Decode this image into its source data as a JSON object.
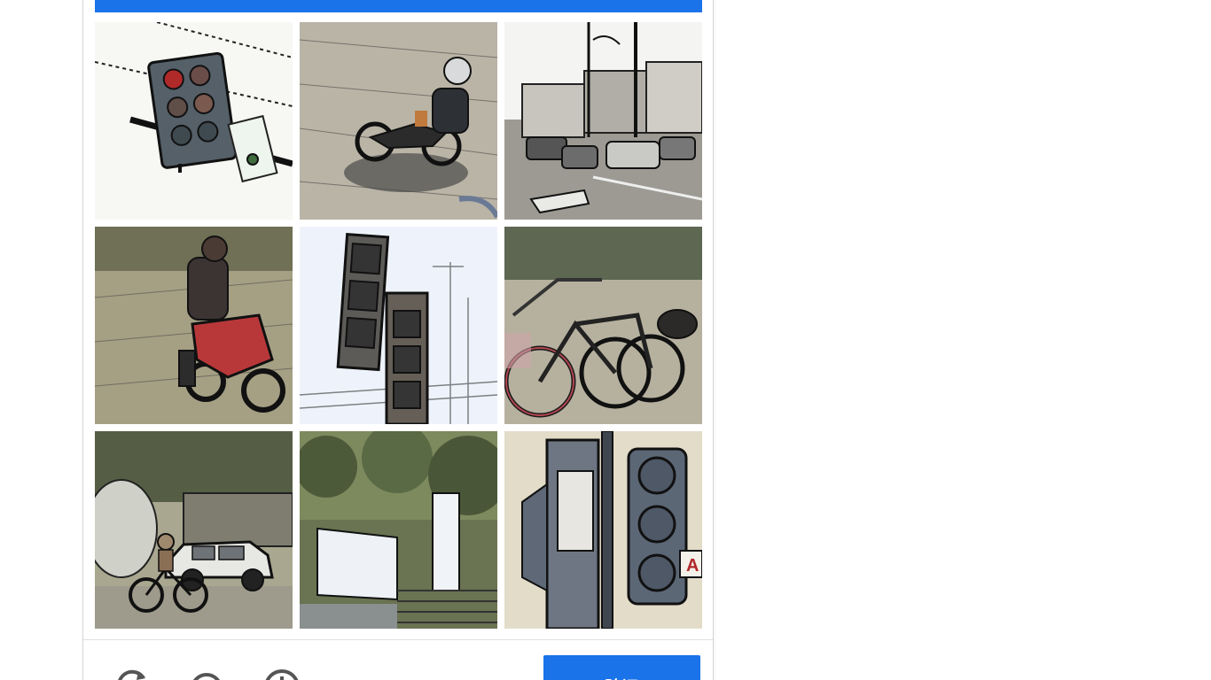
{
  "colors": {
    "accent": "#1a73e8",
    "divider": "#dfdfdf",
    "icon": "#555555"
  },
  "grid": {
    "tiles": [
      {
        "subject": "traffic-light-sign"
      },
      {
        "subject": "motorcycle-rider"
      },
      {
        "subject": "street-intersection"
      },
      {
        "subject": "red-motorcycle"
      },
      {
        "subject": "traffic-lights-sky"
      },
      {
        "subject": "bicycles"
      },
      {
        "subject": "car-and-cyclist"
      },
      {
        "subject": "white-wall-steps"
      },
      {
        "subject": "traffic-signal-poles"
      }
    ]
  },
  "footer": {
    "icons": [
      "reload-icon",
      "headphones-icon",
      "info-icon"
    ],
    "verify_label": "验证"
  }
}
